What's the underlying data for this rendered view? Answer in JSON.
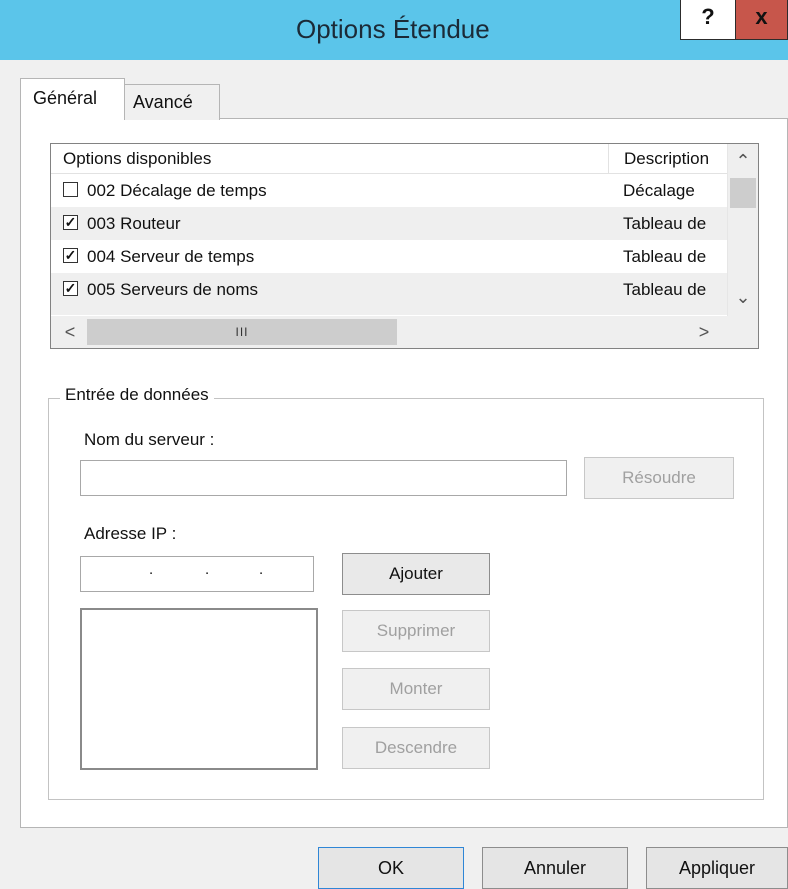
{
  "window": {
    "title": "Options Étendue",
    "help_label": "?",
    "close_label": "x"
  },
  "tabs": [
    {
      "label": "Général"
    },
    {
      "label": "Avancé"
    }
  ],
  "options_list": {
    "columns": [
      "Options disponibles",
      "Description"
    ],
    "rows": [
      {
        "label": "002 Décalage de temps",
        "description": "Décalage",
        "checked": false
      },
      {
        "label": "003 Routeur",
        "description": "Tableau de",
        "checked": true
      },
      {
        "label": "004 Serveur de temps",
        "description": "Tableau de",
        "checked": true
      },
      {
        "label": "005 Serveurs de noms",
        "description": "Tableau de",
        "checked": true
      }
    ],
    "scroll_up": "^",
    "scroll_down": "v",
    "scroll_left": "<",
    "scroll_right": ">",
    "thumb_grip": "III"
  },
  "data_entry": {
    "legend": "Entrée de données",
    "server_name_label": "Nom du serveur :",
    "server_name_value": "",
    "resolve_label": "Résoudre",
    "ip_label": "Adresse IP :",
    "ip_dots": ".",
    "add_label": "Ajouter",
    "remove_label": "Supprimer",
    "up_label": "Monter",
    "down_label": "Descendre"
  },
  "footer": {
    "ok": "OK",
    "cancel": "Annuler",
    "apply": "Appliquer"
  },
  "colors": {
    "titlebar": "#5bc5ea",
    "close": "#c7564b",
    "ok_border": "#2f86d6"
  }
}
